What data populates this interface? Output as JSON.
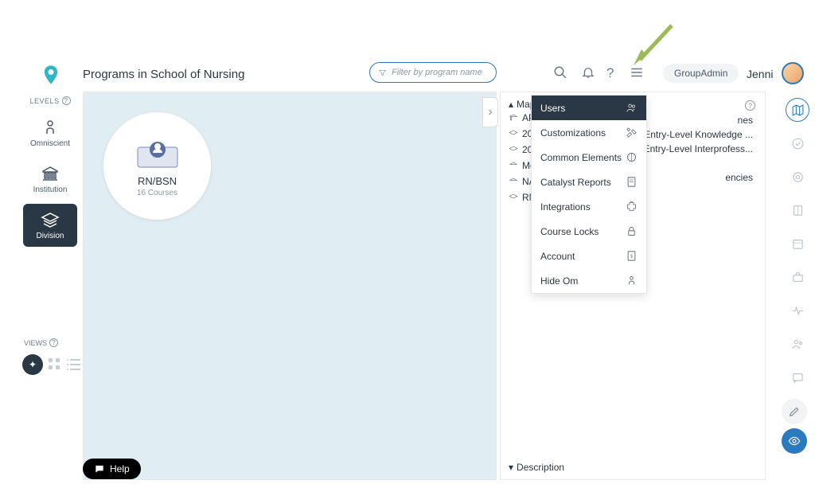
{
  "header": {
    "title": "Programs in School of Nursing",
    "filter_placeholder": "Filter by program name",
    "role_badge": "GroupAdmin",
    "user_name": "Jenni"
  },
  "sidebar": {
    "section_levels": "LEVELS",
    "section_views": "VIEWS",
    "items": [
      {
        "label": "Omniscient"
      },
      {
        "label": "Institution"
      },
      {
        "label": "Division"
      }
    ]
  },
  "program": {
    "title": "RN/BSN",
    "subtitle": "16 Courses"
  },
  "right_panel": {
    "header": "Map",
    "items": [
      {
        "label": "AP U"
      },
      {
        "label": "2021",
        "right": "Entry-Level Knowledge ..."
      },
      {
        "label": "2021",
        "right": "Entry-Level Interprofess..."
      },
      {
        "label": "Medi"
      },
      {
        "label": "NAC",
        "right": "encies"
      },
      {
        "label": "RN/"
      }
    ],
    "right_header": "nes",
    "description_label": "Description"
  },
  "dropdown": {
    "items": [
      {
        "label": "Users",
        "icon": "users-icon",
        "active": true
      },
      {
        "label": "Customizations",
        "icon": "tools-icon"
      },
      {
        "label": "Common Elements",
        "icon": "circle-icon"
      },
      {
        "label": "Catalyst Reports",
        "icon": "report-icon"
      },
      {
        "label": "Integrations",
        "icon": "puzzle-icon"
      },
      {
        "label": "Course Locks",
        "icon": "lock-icon"
      },
      {
        "label": "Account",
        "icon": "account-icon"
      },
      {
        "label": "Hide Om",
        "icon": "person-icon"
      }
    ]
  },
  "help_button": "Help",
  "colors": {
    "primary_dark": "#2a3744",
    "accent_blue": "#2a7abf",
    "canvas_bg": "#e0edf2",
    "arrow_green": "#9bbb59"
  }
}
